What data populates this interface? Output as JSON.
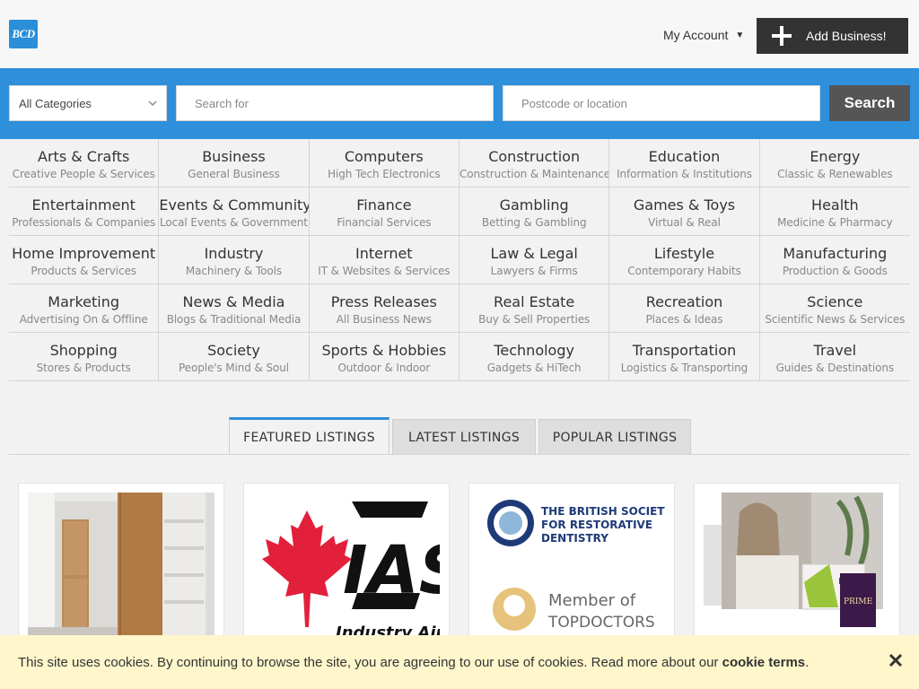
{
  "header": {
    "logo_text": "BCD",
    "account_label": "My Account",
    "add_business_label": "Add Business!"
  },
  "search": {
    "category_selected": "All Categories",
    "query_placeholder": "Search for",
    "location_placeholder": "Postcode or location",
    "button_label": "Search"
  },
  "categories": [
    {
      "title": "Arts & Crafts",
      "sub": "Creative People & Services"
    },
    {
      "title": "Business",
      "sub": "General Business"
    },
    {
      "title": "Computers",
      "sub": "High Tech Electronics"
    },
    {
      "title": "Construction",
      "sub": "Construction & Maintenance"
    },
    {
      "title": "Education",
      "sub": "Information & Institutions"
    },
    {
      "title": "Energy",
      "sub": "Classic & Renewables"
    },
    {
      "title": "Entertainment",
      "sub": "Professionals & Companies"
    },
    {
      "title": "Events & Community",
      "sub": "Local Events & Government"
    },
    {
      "title": "Finance",
      "sub": "Financial Services"
    },
    {
      "title": "Gambling",
      "sub": "Betting & Gambling"
    },
    {
      "title": "Games & Toys",
      "sub": "Virtual & Real"
    },
    {
      "title": "Health",
      "sub": "Medicine & Pharmacy"
    },
    {
      "title": "Home Improvement",
      "sub": "Products & Services"
    },
    {
      "title": "Industry",
      "sub": "Machinery & Tools"
    },
    {
      "title": "Internet",
      "sub": "IT & Websites & Services"
    },
    {
      "title": "Law & Legal",
      "sub": "Lawyers & Firms"
    },
    {
      "title": "Lifestyle",
      "sub": "Contemporary Habits"
    },
    {
      "title": "Manufacturing",
      "sub": "Production & Goods"
    },
    {
      "title": "Marketing",
      "sub": "Advertising On & Offline"
    },
    {
      "title": "News & Media",
      "sub": "Blogs & Traditional Media"
    },
    {
      "title": "Press Releases",
      "sub": "All Business News"
    },
    {
      "title": "Real Estate",
      "sub": "Buy & Sell Properties"
    },
    {
      "title": "Recreation",
      "sub": "Places & Ideas"
    },
    {
      "title": "Science",
      "sub": "Scientific News & Services"
    },
    {
      "title": "Shopping",
      "sub": "Stores & Products"
    },
    {
      "title": "Society",
      "sub": "People's Mind & Soul"
    },
    {
      "title": "Sports & Hobbies",
      "sub": "Outdoor & Indoor"
    },
    {
      "title": "Technology",
      "sub": "Gadgets & HiTech"
    },
    {
      "title": "Transportation",
      "sub": "Logistics & Transporting"
    },
    {
      "title": "Travel",
      "sub": "Guides & Destinations"
    }
  ],
  "tabs": [
    {
      "label": "FEATURED LISTINGS",
      "active": true
    },
    {
      "label": "LATEST LISTINGS",
      "active": false
    },
    {
      "label": "POPULAR LISTINGS",
      "active": false
    }
  ],
  "listings": [
    {
      "image": "wardrobe-photo"
    },
    {
      "image": "ias-logo",
      "logo_text": "IAS",
      "logo_sub": "Industry Air"
    },
    {
      "image": "bsrd-logo",
      "logo_line1": "THE BRITISH SOCIETY",
      "logo_line2": "FOR RESTORATIVE",
      "logo_line3": "DENTISTRY",
      "badge_line1": "Member of",
      "badge_line2": "TOPDOCTORS"
    },
    {
      "image": "skincare-photo",
      "product_text": "PRIME"
    }
  ],
  "cookie": {
    "text": "This site uses cookies. By continuing to browse the site, you are agreeing to our use of cookies. Read more about our ",
    "link": "cookie terms",
    "suffix": "."
  },
  "colors": {
    "brand_blue": "#2e8fdb",
    "dark_button": "#333333",
    "cookie_bg": "#fff6cc"
  }
}
